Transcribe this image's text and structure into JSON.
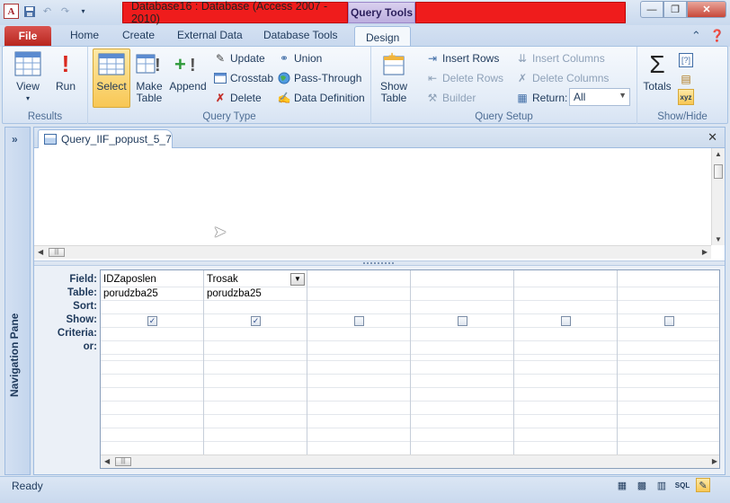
{
  "titlebar": {
    "title": "Database16 : Database (Access 2007 - 2010)",
    "context_tab": "Query Tools"
  },
  "tabs": {
    "file": "File",
    "home": "Home",
    "create": "Create",
    "external": "External Data",
    "dbtools": "Database Tools",
    "design": "Design"
  },
  "ribbon": {
    "results": {
      "label": "Results",
      "view": "View",
      "run": "Run"
    },
    "query_type": {
      "label": "Query Type",
      "select": "Select",
      "make_table_1": "Make",
      "make_table_2": "Table",
      "append": "Append",
      "update": "Update",
      "crosstab": "Crosstab",
      "delete": "Delete",
      "union": "Union",
      "pass_through": "Pass-Through",
      "data_definition": "Data Definition"
    },
    "query_setup": {
      "label": "Query Setup",
      "show_table_1": "Show",
      "show_table_2": "Table",
      "insert_rows": "Insert Rows",
      "delete_rows": "Delete Rows",
      "builder": "Builder",
      "insert_columns": "Insert Columns",
      "delete_columns": "Delete Columns",
      "return_label": "Return:",
      "return_value": "All"
    },
    "show_hide": {
      "label": "Show/Hide",
      "totals": "Totals"
    }
  },
  "nav_pane": {
    "label": "Navigation Pane"
  },
  "document": {
    "tab_title": "Query_IIF_popust_5_7"
  },
  "design_grid": {
    "row_labels": [
      "Field:",
      "Table:",
      "Sort:",
      "Show:",
      "Criteria:",
      "or:"
    ],
    "columns": [
      {
        "field": "IDZaposlen",
        "table": "porudzba25",
        "show": true
      },
      {
        "field": "Trosak",
        "table": "porudzba25",
        "show": true
      },
      {
        "field": "",
        "table": "",
        "show": false
      },
      {
        "field": "",
        "table": "",
        "show": false
      },
      {
        "field": "",
        "table": "",
        "show": false
      },
      {
        "field": "",
        "table": "",
        "show": false
      }
    ]
  },
  "statusbar": {
    "text": "Ready",
    "sql_label": "SQL"
  }
}
